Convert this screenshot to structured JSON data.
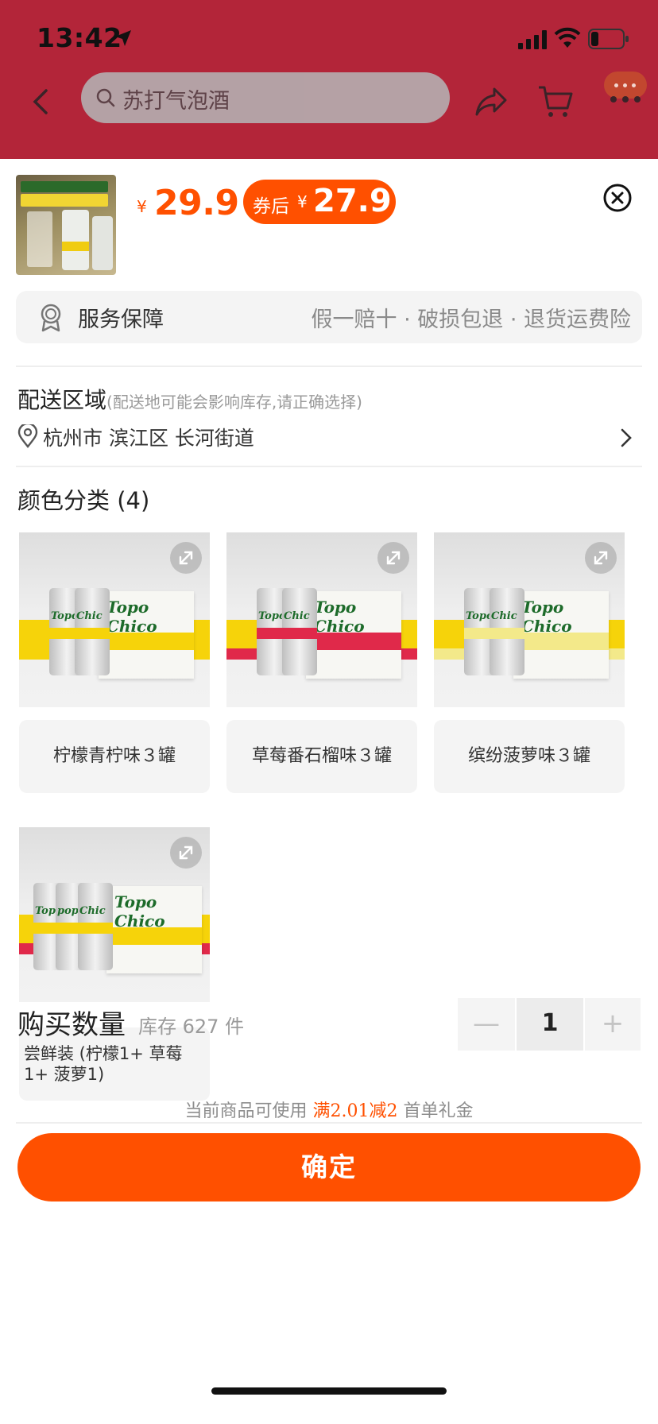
{
  "status_bar": {
    "time": "13:42"
  },
  "header": {
    "search_text": "苏打气泡酒"
  },
  "product": {
    "currency": "¥",
    "price": "29.9",
    "coupon_label": "券后",
    "coupon_currency": "¥",
    "coupon_price": "27.9"
  },
  "service": {
    "title": "服务保障",
    "desc": "假一赔十 · 破损包退 · 退货运费险"
  },
  "shipping": {
    "title": "配送区域",
    "note": "(配送地可能会影响库存,请正确选择)",
    "address": "杭州市 滨江区 长河街道"
  },
  "variants": {
    "title": "颜色分类 (4)",
    "items": [
      {
        "label": "柠檬青柠味３罐",
        "stripe_color": "#f6d30a"
      },
      {
        "label": "草莓番石榴味３罐",
        "stripe_color": "#e0294a"
      },
      {
        "label": "缤纷菠萝味３罐",
        "stripe_color": "#f3e98a"
      },
      {
        "label": "尝鲜装 (柠檬1+ 草莓1+ 菠萝1)",
        "stripe_color": "#f6d30a"
      }
    ]
  },
  "quantity": {
    "title": "购买数量",
    "stock": "库存 627 件",
    "value": "1",
    "minus": "—",
    "plus": "+"
  },
  "promo": {
    "prefix": "当前商品可使用",
    "highlight": "满2.01减2",
    "suffix": "首单礼金"
  },
  "confirm_label": "确定",
  "colors": {
    "accent": "#ff5000",
    "header_bg": "#b32539"
  }
}
